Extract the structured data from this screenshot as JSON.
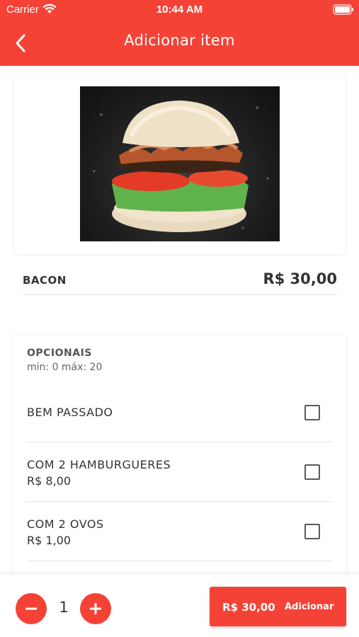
{
  "status_bar": {
    "carrier": "Carrier",
    "time": "10:44 AM"
  },
  "header": {
    "title": "Adicionar item",
    "background": "#f44336"
  },
  "product": {
    "name": "BACON",
    "price": "R$ 30,00",
    "image_icon": "burger-photo"
  },
  "options": {
    "title": "OPCIONAIS",
    "limits": "min: 0   máx: 20",
    "items": [
      {
        "name": "BEM PASSADO",
        "price": ""
      },
      {
        "name": "COM 2 HAMBURGUERES",
        "price": "R$ 8,00"
      },
      {
        "name": "COM 2 OVOS",
        "price": "R$ 1,00"
      }
    ]
  },
  "footer": {
    "quantity": "1",
    "total": "R$ 30,00",
    "add_label": "Adicionar"
  },
  "colors": {
    "accent": "#f44336"
  }
}
